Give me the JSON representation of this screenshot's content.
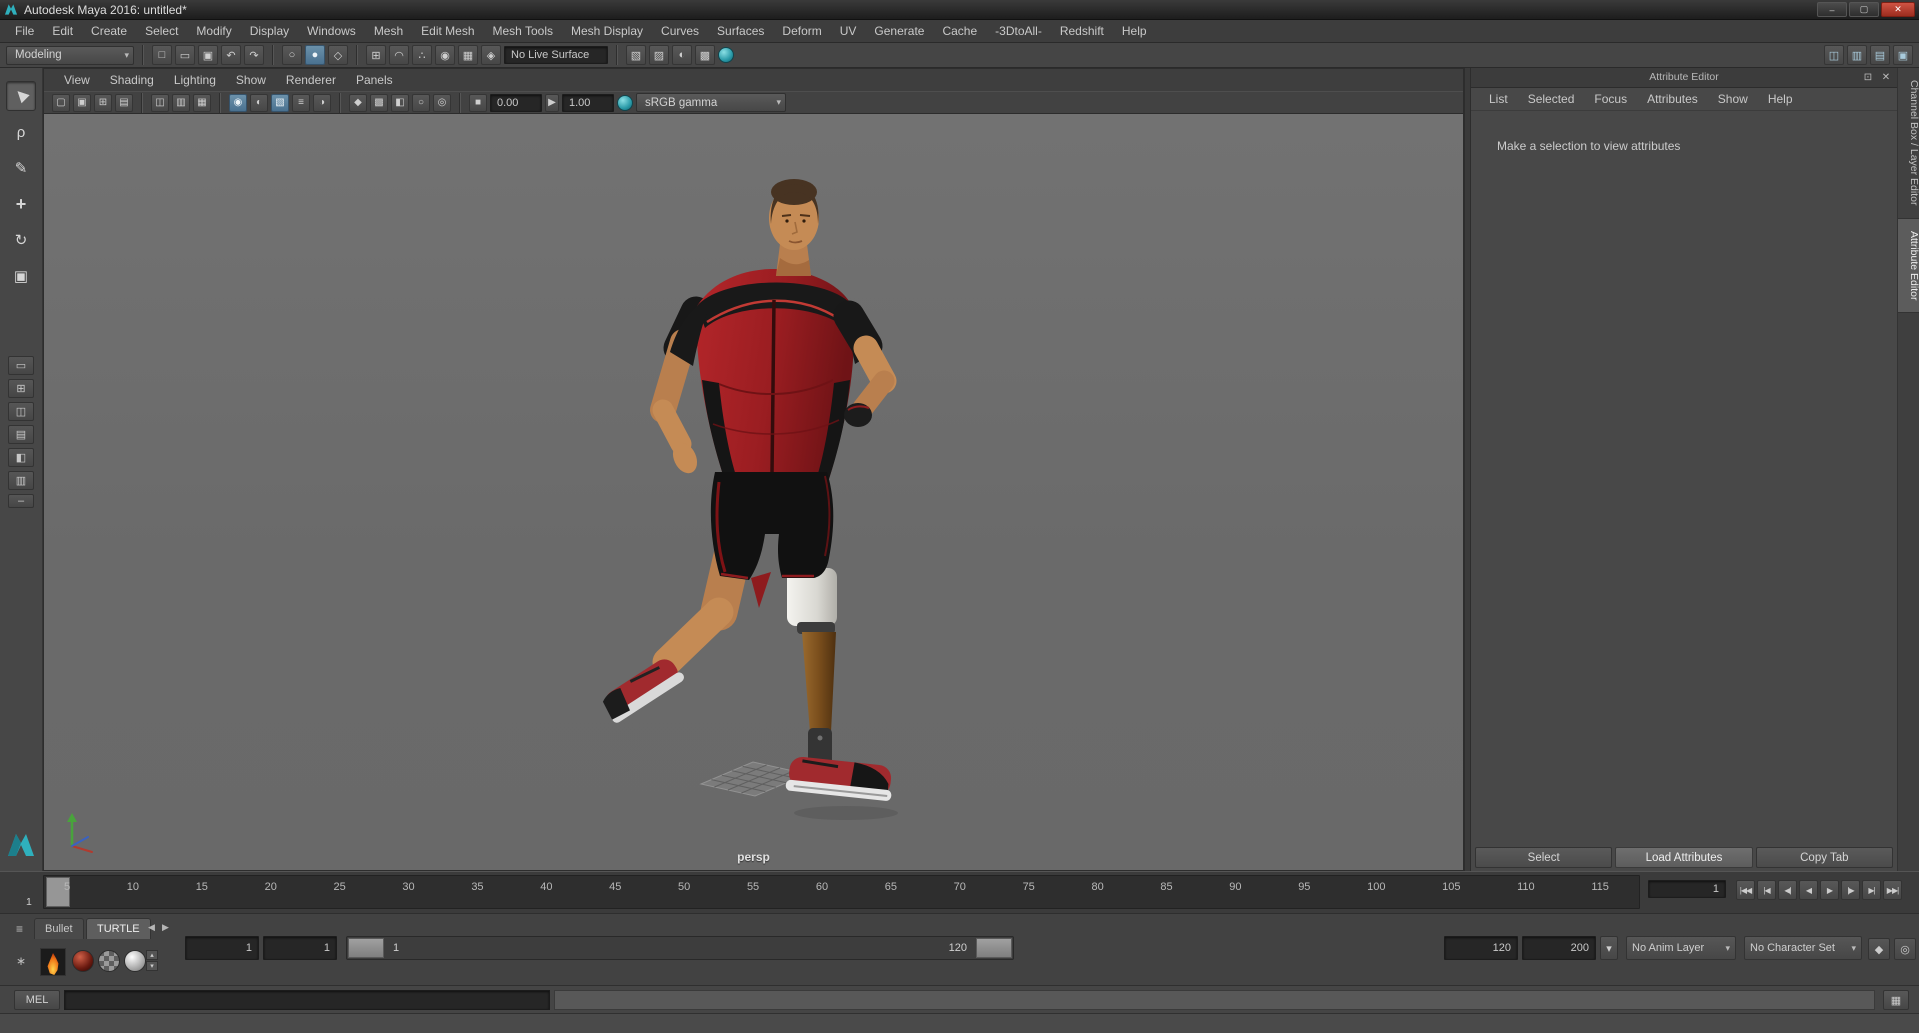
{
  "window": {
    "title": "Autodesk Maya 2016: untitled*"
  },
  "window_controls": {
    "minimize": "–",
    "maximize": "▢",
    "close": "✕"
  },
  "menubar": {
    "items": [
      "File",
      "Edit",
      "Create",
      "Select",
      "Modify",
      "Display",
      "Windows",
      "Mesh",
      "Edit Mesh",
      "Mesh Tools",
      "Mesh Display",
      "Curves",
      "Surfaces",
      "Deform",
      "UV",
      "Generate",
      "Cache",
      "-3DtoAll-",
      "Redshift",
      "Help"
    ]
  },
  "status_line": {
    "mode_selector": "Modeling",
    "caret": "▾",
    "live_surface": "No Live Surface",
    "file_icons": [
      "□",
      "▭",
      "▣"
    ],
    "edit_icons": [
      "↶",
      "↷"
    ],
    "mask_icons": [
      "○",
      "●",
      "◇"
    ],
    "snap_icons": [
      "⊞",
      "◠",
      "∴",
      "◉",
      "▦",
      "◈"
    ],
    "hist_icons": [
      "▧",
      "▨",
      "◐",
      "▩"
    ],
    "ws_icons": [
      "◫",
      "▥",
      "▤",
      "▣"
    ]
  },
  "toolbox": {
    "tools": [
      "▶",
      "ρ",
      "✎",
      "+",
      "↻",
      "▣"
    ],
    "layouts": [
      "▭",
      "⊞",
      "◫",
      "▤",
      "◧",
      "▥"
    ],
    "minus": "–"
  },
  "viewport": {
    "menus": [
      "View",
      "Shading",
      "Lighting",
      "Show",
      "Renderer",
      "Panels"
    ],
    "icons": [
      "▢",
      "▣",
      "⊞",
      "▤",
      "◫",
      "▥",
      "▦",
      "◉",
      "◐",
      "▧",
      "≡",
      "◑",
      "◆",
      "▩",
      "◧",
      "○",
      "◎",
      "■"
    ],
    "exposure": "0.00",
    "exposure_toggle": "▶",
    "gamma": "1.00",
    "view_transform": "sRGB gamma",
    "caret": "▾",
    "camera_label": "persp"
  },
  "attribute_editor": {
    "title": "Attribute Editor",
    "float_icon": "⊡",
    "close_icon": "✕",
    "menus": [
      "List",
      "Selected",
      "Focus",
      "Attributes",
      "Show",
      "Help"
    ],
    "message": "Make a selection to view attributes",
    "buttons": [
      "Select",
      "Load Attributes",
      "Copy Tab"
    ]
  },
  "side_tabs": {
    "channel_box": "Channel Box / Layer Editor",
    "attribute_editor": "Attribute Editor"
  },
  "timeline": {
    "ticks": [
      "5",
      "10",
      "15",
      "20",
      "25",
      "30",
      "35",
      "40",
      "45",
      "50",
      "55",
      "60",
      "65",
      "70",
      "75",
      "80",
      "85",
      "90",
      "95",
      "100",
      "105",
      "110",
      "115"
    ],
    "current_frame": "1",
    "frame_field": "1",
    "playback": [
      "|◀◀",
      "|◀",
      "◀|",
      "◀",
      "▶",
      "|▶",
      "▶|",
      "▶▶|"
    ]
  },
  "range_slider": {
    "fields": {
      "start": "1",
      "min": "1",
      "end": "120",
      "max": "200"
    },
    "bar": {
      "start_label": "1",
      "end_label": "120"
    },
    "caret": "▾",
    "anim_layer": "No Anim Layer",
    "character_set": "No Character Set",
    "key_icon": "◆",
    "charset_icon": "◎"
  },
  "shelf": {
    "hamburger": "≡",
    "gear": "∗",
    "tabs": [
      "Bullet",
      "TURTLE"
    ],
    "arrows": [
      "◀",
      "▶"
    ],
    "spinner": [
      "▴",
      "▾"
    ]
  },
  "command_line": {
    "label": "MEL",
    "script_icon": "▦"
  }
}
